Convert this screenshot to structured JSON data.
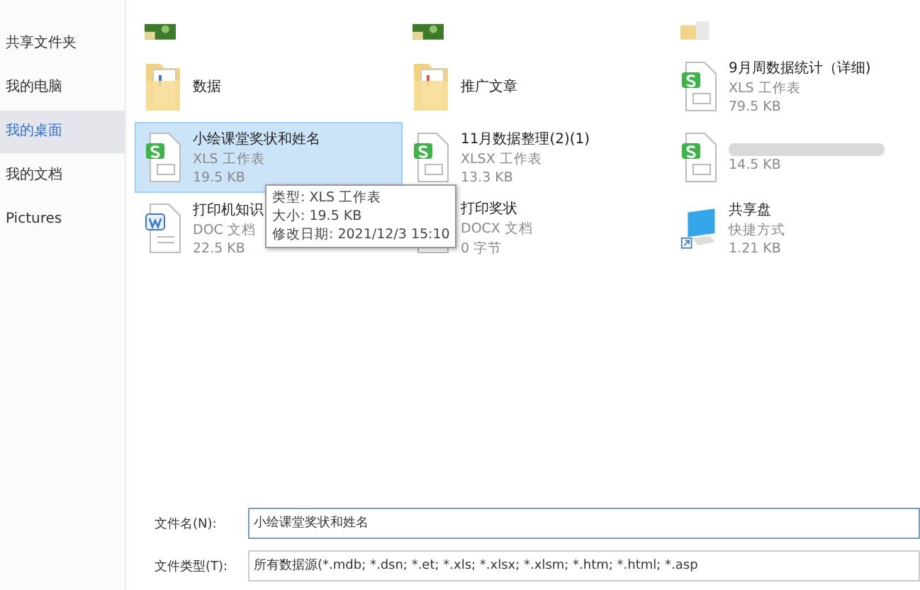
{
  "sidebar": {
    "items": [
      {
        "label": "共享文件夹",
        "selected": false
      },
      {
        "label": "我的电脑",
        "selected": false
      },
      {
        "label": "我的桌面",
        "selected": true
      },
      {
        "label": "我的文档",
        "selected": false
      },
      {
        "label": "Pictures",
        "selected": false
      }
    ]
  },
  "files": [
    {
      "kind": "image",
      "selected": false
    },
    {
      "kind": "image",
      "selected": false
    },
    {
      "kind": "folder",
      "selected": false
    },
    {
      "kind": "folder",
      "name": "数据",
      "selected": false
    },
    {
      "kind": "folder",
      "name": "推广文章",
      "selected": false
    },
    {
      "kind": "xls",
      "name": "9月周数据统计（详细)",
      "type": "XLS 工作表",
      "size": "79.5 KB",
      "selected": false
    },
    {
      "kind": "xls",
      "name": "小绘课堂奖状和姓名",
      "type": "XLS 工作表",
      "size": "19.5 KB",
      "selected": true
    },
    {
      "kind": "xls",
      "name": "11月数据整理(2)(1)",
      "type": "XLSX 工作表",
      "size": "13.3 KB",
      "selected": false
    },
    {
      "kind": "redacted",
      "size": "14.5 KB",
      "selected": false
    },
    {
      "kind": "doc",
      "name": "打印机知识",
      "type": "DOC 文档",
      "size": "22.5 KB",
      "selected": false
    },
    {
      "kind": "doc",
      "name": "打印奖状",
      "type": "DOCX 文档",
      "size": "0 字节",
      "selected": false
    },
    {
      "kind": "shortcut",
      "name": "共享盘",
      "type": "快捷方式",
      "size": "1.21 KB",
      "selected": false
    }
  ],
  "tooltip": [
    "类型: XLS 工作表",
    "大小: 19.5 KB",
    "修改日期: 2021/12/3 15:10"
  ],
  "fields": [
    {
      "label": "文件名(N):",
      "value": "小绘课堂奖状和姓名"
    },
    {
      "label": "文件类型(T):",
      "value": "所有数据源(*.mdb; *.dsn; *.et; *.xls; *.xlsx; *.xlsm; *.htm; *.html; *.asp"
    }
  ]
}
